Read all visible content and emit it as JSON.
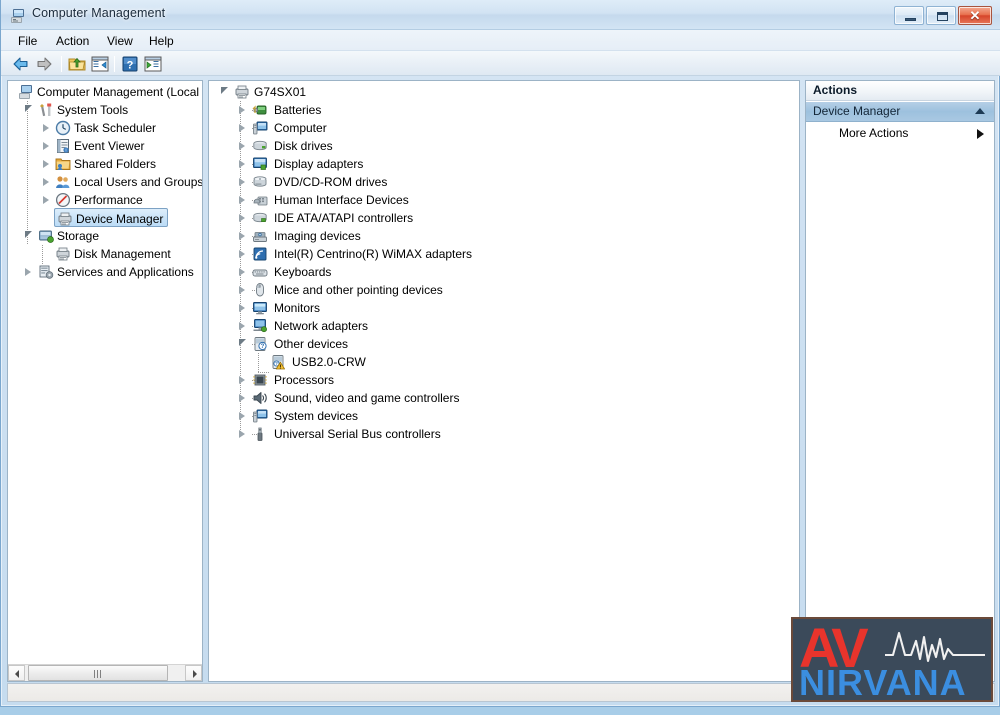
{
  "window": {
    "title": "Computer Management",
    "icon": "computer-management-icon",
    "controls": {
      "minimize": "Minimize",
      "maximize": "Maximize",
      "close": "✕"
    }
  },
  "menubar": {
    "items": [
      {
        "label": "File"
      },
      {
        "label": "Action"
      },
      {
        "label": "View"
      },
      {
        "label": "Help"
      }
    ]
  },
  "toolbar": {
    "buttons": [
      {
        "name": "back-button",
        "icon": "back-arrow-icon"
      },
      {
        "name": "forward-button",
        "icon": "forward-arrow-icon"
      },
      {
        "name": "up-one-level-button",
        "icon": "folder-up-icon"
      },
      {
        "name": "show-hide-console-tree-button",
        "icon": "console-tree-icon"
      },
      {
        "name": "help-button",
        "icon": "question-mark-icon"
      },
      {
        "name": "show-hide-action-pane-button",
        "icon": "action-pane-icon"
      }
    ]
  },
  "console_tree": {
    "items": [
      {
        "label": "Computer Management (Local",
        "indent": 0,
        "expander": "open",
        "icon": "computer-icon",
        "selected": false
      },
      {
        "label": "System Tools",
        "indent": 1,
        "expander": "open",
        "icon": "tools-icon",
        "selected": false
      },
      {
        "label": "Task Scheduler",
        "indent": 2,
        "expander": "closed",
        "icon": "clock-icon",
        "selected": false
      },
      {
        "label": "Event Viewer",
        "indent": 2,
        "expander": "closed",
        "icon": "event-log-icon",
        "selected": false
      },
      {
        "label": "Shared Folders",
        "indent": 2,
        "expander": "closed",
        "icon": "shared-folder-icon",
        "selected": false
      },
      {
        "label": "Local Users and Groups",
        "indent": 2,
        "expander": "closed",
        "icon": "users-icon",
        "selected": false
      },
      {
        "label": "Performance",
        "indent": 2,
        "expander": "closed",
        "icon": "performance-icon",
        "selected": false
      },
      {
        "label": "Device Manager",
        "indent": 2,
        "expander": "none",
        "icon": "device-manager-icon",
        "selected": true
      },
      {
        "label": "Storage",
        "indent": 1,
        "expander": "open",
        "icon": "storage-icon",
        "selected": false
      },
      {
        "label": "Disk Management",
        "indent": 2,
        "expander": "none",
        "icon": "disk-management-icon",
        "selected": false
      },
      {
        "label": "Services and Applications",
        "indent": 1,
        "expander": "closed",
        "icon": "services-icon",
        "selected": false
      }
    ]
  },
  "device_tree": {
    "root": {
      "label": "G74SX01",
      "expander": "open",
      "icon": "computer-node-icon"
    },
    "items": [
      {
        "label": "Batteries",
        "expander": "closed",
        "icon": "battery-icon",
        "warning": false,
        "depth": 1
      },
      {
        "label": "Computer",
        "expander": "closed",
        "icon": "computer-icon",
        "warning": false,
        "depth": 1
      },
      {
        "label": "Disk drives",
        "expander": "closed",
        "icon": "disk-drive-icon",
        "warning": false,
        "depth": 1
      },
      {
        "label": "Display adapters",
        "expander": "closed",
        "icon": "display-adapter-icon",
        "warning": false,
        "depth": 1
      },
      {
        "label": "DVD/CD-ROM drives",
        "expander": "closed",
        "icon": "optical-drive-icon",
        "warning": false,
        "depth": 1
      },
      {
        "label": "Human Interface Devices",
        "expander": "closed",
        "icon": "hid-icon",
        "warning": false,
        "depth": 1
      },
      {
        "label": "IDE ATA/ATAPI controllers",
        "expander": "closed",
        "icon": "ide-controller-icon",
        "warning": false,
        "depth": 1
      },
      {
        "label": "Imaging devices",
        "expander": "closed",
        "icon": "imaging-device-icon",
        "warning": false,
        "depth": 1
      },
      {
        "label": "Intel(R) Centrino(R) WiMAX adapters",
        "expander": "closed",
        "icon": "wimax-adapter-icon",
        "warning": false,
        "depth": 1
      },
      {
        "label": "Keyboards",
        "expander": "closed",
        "icon": "keyboard-icon",
        "warning": false,
        "depth": 1
      },
      {
        "label": "Mice and other pointing devices",
        "expander": "closed",
        "icon": "mouse-icon",
        "warning": false,
        "depth": 1
      },
      {
        "label": "Monitors",
        "expander": "closed",
        "icon": "monitor-icon",
        "warning": false,
        "depth": 1
      },
      {
        "label": "Network adapters",
        "expander": "closed",
        "icon": "network-adapter-icon",
        "warning": false,
        "depth": 1
      },
      {
        "label": "Other devices",
        "expander": "open",
        "icon": "unknown-device-icon",
        "warning": false,
        "depth": 1
      },
      {
        "label": "USB2.0-CRW",
        "expander": "none",
        "icon": "unknown-device-icon",
        "warning": true,
        "depth": 2
      },
      {
        "label": "Processors",
        "expander": "closed",
        "icon": "processor-icon",
        "warning": false,
        "depth": 1
      },
      {
        "label": "Sound, video and game controllers",
        "expander": "closed",
        "icon": "sound-icon",
        "warning": false,
        "depth": 1
      },
      {
        "label": "System devices",
        "expander": "closed",
        "icon": "system-device-icon",
        "warning": false,
        "depth": 1
      },
      {
        "label": "Universal Serial Bus controllers",
        "expander": "closed",
        "icon": "usb-controller-icon",
        "warning": false,
        "depth": 1
      }
    ]
  },
  "actions_pane": {
    "header": "Actions",
    "group_label": "Device Manager",
    "more_actions_label": "More Actions"
  },
  "statusbar": {
    "text": ""
  },
  "watermark": {
    "line1": "AV",
    "line2": "NIRVANA",
    "color_av": "#e8342c",
    "color_nirvana": "#3b8ee0",
    "background": "#3b4a5a"
  },
  "colors": {
    "selection_border": "#7da2c4",
    "actions_group_bg": "#9dc1de",
    "close_button": "#d6452a",
    "warning_badge": "#f5c034"
  }
}
